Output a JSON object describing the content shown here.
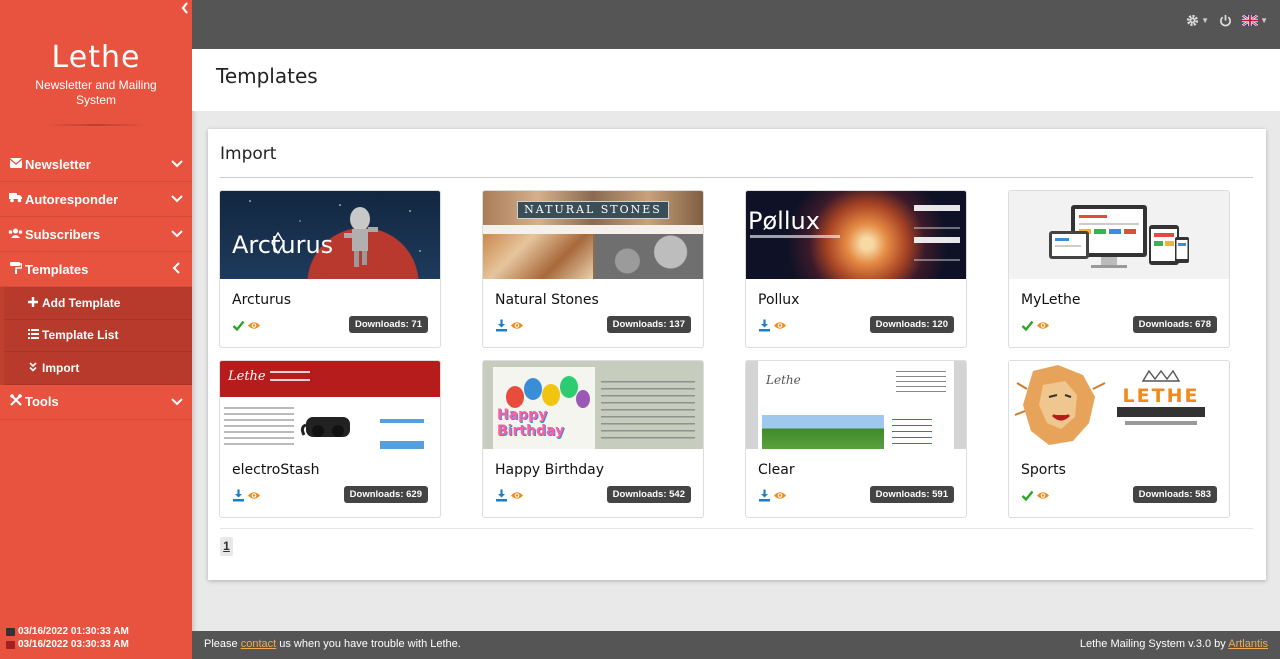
{
  "brand": {
    "name": "Lethe",
    "subtitle": "Newsletter and Mailing System"
  },
  "sidebar": {
    "items": [
      {
        "label": "Newsletter",
        "icon": "envelope-icon"
      },
      {
        "label": "Autoresponder",
        "icon": "truck-icon"
      },
      {
        "label": "Subscribers",
        "icon": "users-icon"
      },
      {
        "label": "Templates",
        "icon": "paint-roller-icon",
        "expanded": true,
        "children": [
          {
            "label": "Add Template",
            "icon": "plus-icon"
          },
          {
            "label": "Template List",
            "icon": "list-icon"
          },
          {
            "label": "Import",
            "icon": "double-chevron-down-icon"
          }
        ]
      },
      {
        "label": "Tools",
        "icon": "tools-icon"
      }
    ],
    "times": [
      "03/16/2022 01:30:33 AM",
      "03/16/2022 03:30:33 AM"
    ]
  },
  "topbar": {
    "icons": [
      "gear-icon",
      "power-icon",
      "uk-flag-icon"
    ]
  },
  "page": {
    "title": "Templates"
  },
  "panel": {
    "title": "Import",
    "cards": [
      {
        "name": "Arcturus",
        "downloads": "Downloads: 71",
        "installed": true,
        "thumb_text": "Arcturus"
      },
      {
        "name": "Natural Stones",
        "downloads": "Downloads: 137",
        "installed": false,
        "thumb_text": "NATURAL STONES"
      },
      {
        "name": "Pollux",
        "downloads": "Downloads: 120",
        "installed": false,
        "thumb_text": "Pøllux"
      },
      {
        "name": "MyLethe",
        "downloads": "Downloads: 678",
        "installed": true,
        "thumb_text": ""
      },
      {
        "name": "electroStash",
        "downloads": "Downloads: 629",
        "installed": false,
        "thumb_text": "Lethe"
      },
      {
        "name": "Happy Birthday",
        "downloads": "Downloads: 542",
        "installed": false,
        "thumb_text": "Happy Birthday"
      },
      {
        "name": "Clear",
        "downloads": "Downloads: 591",
        "installed": false,
        "thumb_text": "Lethe"
      },
      {
        "name": "Sports",
        "downloads": "Downloads: 583",
        "installed": true,
        "thumb_text": "LETHE"
      }
    ],
    "pagination": {
      "current": "1"
    }
  },
  "footer": {
    "left_prefix": "Please ",
    "left_link": "contact",
    "left_suffix": " us when you have trouble with Lethe.",
    "right_prefix": "Lethe Mailing System v.3.0 by ",
    "right_link": "Artlantis"
  },
  "colors": {
    "sidebar": "#e8533f",
    "topbar": "#555555",
    "installed": "#2aa52a",
    "download": "#1a7fc4",
    "preview": "#f08a1c"
  }
}
